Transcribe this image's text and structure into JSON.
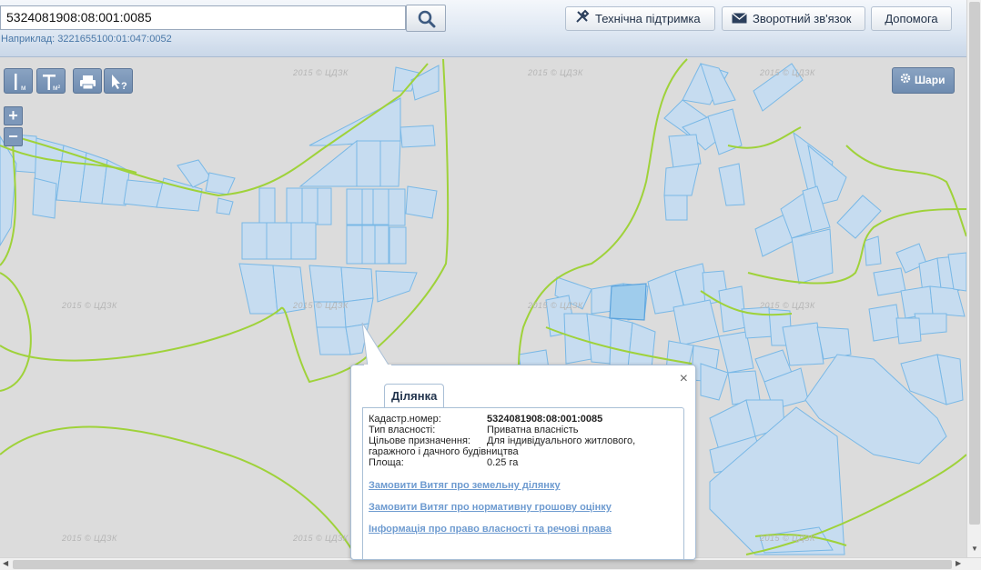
{
  "header": {
    "search_value": "5324081908:08:001:0085",
    "example_text": "Наприклад: 3221655100:01:047:0052",
    "buttons": {
      "support": "Технічна підтримка",
      "feedback": "Зворотний зв'язок",
      "help": "Допомога"
    },
    "icons": {
      "search": "search-icon",
      "support": "tools-icon",
      "feedback": "envelope-icon"
    }
  },
  "toolbar": {
    "tools": [
      {
        "name": "measure-distance-tool",
        "glyph": "I",
        "sub": "м"
      },
      {
        "name": "measure-area-tool",
        "glyph": "┬",
        "sub": "м²"
      },
      {
        "name": "print-tool",
        "glyph": "print"
      },
      {
        "name": "identify-tool",
        "glyph": "↖?"
      }
    ],
    "zoom_in": "+",
    "zoom_out": "−",
    "layers_label": "Шари"
  },
  "map": {
    "watermark": "2015 © ЦДЗК",
    "colors": {
      "background": "#dcdcdc",
      "parcel_fill": "#c6dcf0",
      "parcel_stroke": "#79b8e6",
      "selected_parcel_fill": "#9fccec",
      "boundary": "#9fd23a"
    }
  },
  "popup": {
    "tab_label": "Ділянка",
    "close_label": "×",
    "rows": [
      {
        "key": "Кадастр.номер:",
        "value": "5324081908:08:001:0085"
      },
      {
        "key": "Тип власності:",
        "value": "Приватна власність"
      },
      {
        "key": "Цільове призначення:",
        "value": "Для індивідуального житлового, гаражного і дачного будівництва"
      },
      {
        "key": "Площа:",
        "value": "0.25 га"
      }
    ],
    "links": [
      "Замовити Витяг про земельну ділянку",
      "Замовити Витяг про нормативну грошову оцінку",
      "Інформація про право власності та речові права"
    ]
  }
}
